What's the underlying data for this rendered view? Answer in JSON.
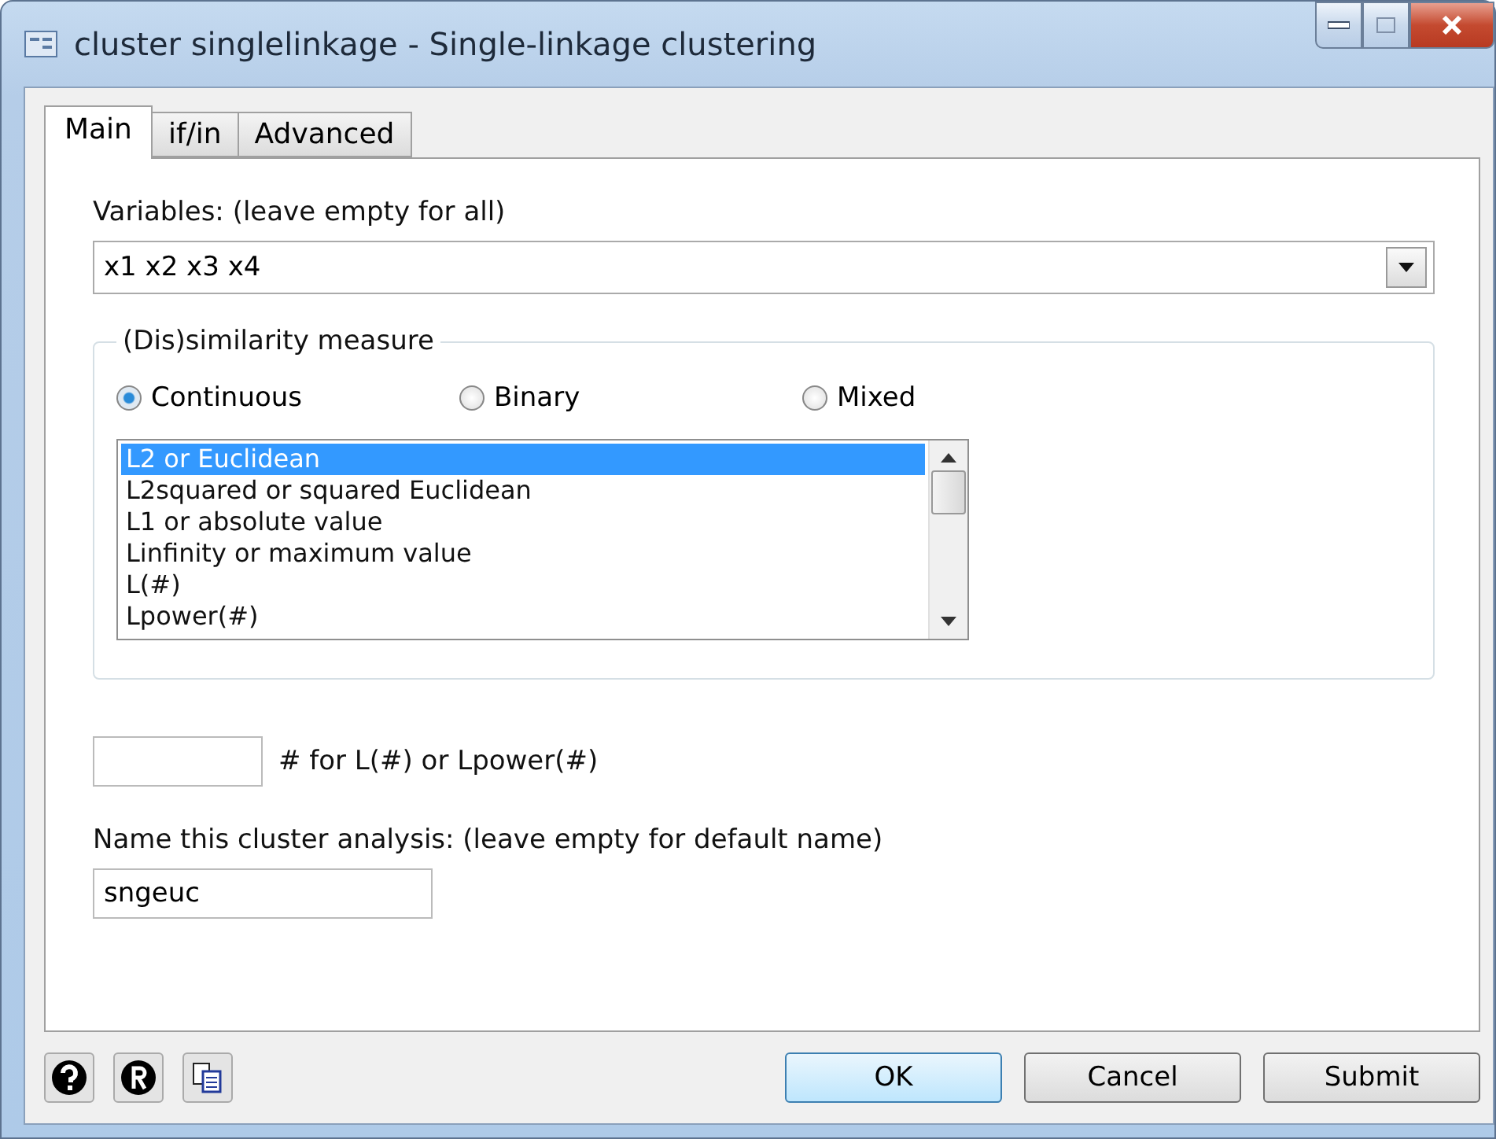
{
  "window": {
    "title": "cluster singlelinkage - Single-linkage clustering"
  },
  "tabs": [
    {
      "label": "Main",
      "selected": true
    },
    {
      "label": "if/in",
      "selected": false
    },
    {
      "label": "Advanced",
      "selected": false
    }
  ],
  "variables": {
    "label": "Variables: (leave empty for all)",
    "value": "x1 x2 x3 x4"
  },
  "measure": {
    "legend": "(Dis)similarity measure",
    "options": [
      {
        "label": "Continuous",
        "selected": true
      },
      {
        "label": "Binary",
        "selected": false
      },
      {
        "label": "Mixed",
        "selected": false
      }
    ],
    "list": [
      {
        "label": "L2 or Euclidean",
        "selected": true
      },
      {
        "label": "L2squared or squared Euclidean",
        "selected": false
      },
      {
        "label": "L1 or absolute value",
        "selected": false
      },
      {
        "label": "Linfinity or maximum value",
        "selected": false
      },
      {
        "label": "L(#)",
        "selected": false
      },
      {
        "label": "Lpower(#)",
        "selected": false
      }
    ]
  },
  "power": {
    "label": "# for L(#) or Lpower(#)"
  },
  "name": {
    "label": "Name this cluster analysis: (leave empty for default name)",
    "value": "sngeuc"
  },
  "buttons": [
    {
      "label": "OK",
      "default": true
    },
    {
      "label": "Cancel",
      "default": false
    },
    {
      "label": "Submit",
      "default": false
    }
  ]
}
